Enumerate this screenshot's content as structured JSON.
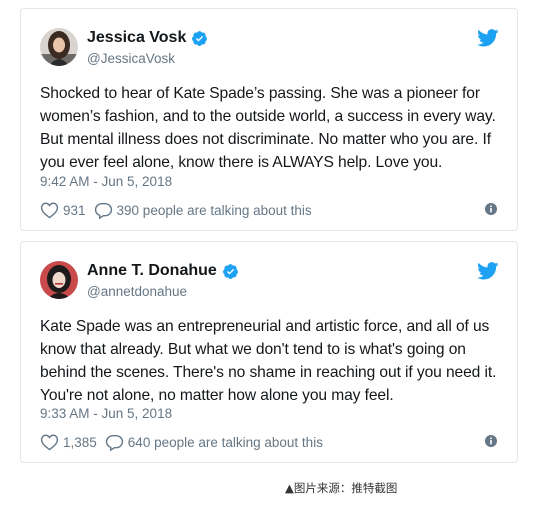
{
  "tweets": [
    {
      "display_name": "Jessica Vosk",
      "handle": "@JessicaVosk",
      "text": "Shocked to hear of Kate Spade’s passing. She was a pioneer for women’s fashion, and to the outside world, a success in every way. But mental illness does not discriminate. No matter who you are. If you ever feel alone, know there is ALWAYS help. Love you.",
      "timestamp": "9:42 AM - Jun 5, 2018",
      "likes": "931",
      "talking": "390 people are talking about this",
      "avatar_icon": "user-avatar-photo"
    },
    {
      "display_name": "Anne T. Donahue",
      "handle": "@annetdonahue",
      "text": "Kate Spade was an entrepreneurial and artistic force, and all of us know that already. But what we don't tend to is what's going on behind the scenes. There's no shame in reaching out if you need it. You're not alone, no matter how alone you may feel.",
      "timestamp": "9:33 AM - Jun 5, 2018",
      "likes": "1,385",
      "talking": "640 people are talking about this",
      "avatar_icon": "user-avatar-photo"
    }
  ],
  "caption": "▲图片来源：推特截图",
  "icons": {
    "verified": "verified-badge-icon",
    "bird": "twitter-bird-icon",
    "heart": "heart-icon",
    "reply": "reply-bubble-icon",
    "info": "info-icon"
  },
  "colors": {
    "twitter_blue": "#1da1f2",
    "secondary_text": "#657786",
    "primary_text": "#14171a",
    "card_border": "#e1e8ed"
  }
}
